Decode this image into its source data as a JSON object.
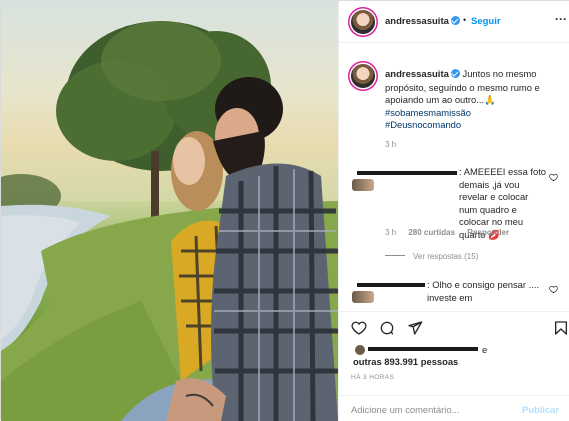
{
  "post": {
    "username": "andressasuita",
    "follow_label": "Seguir",
    "separator": "•",
    "more_label": "···"
  },
  "caption": {
    "username": "andressasuita",
    "text": " Juntos no mesmo propósito, seguindo o mesmo rumo e apoiando um ao outro...🙏",
    "hashtags": [
      "#sobamesmamissão",
      "#Deusnocomando"
    ],
    "time": "3 h"
  },
  "comments": [
    {
      "text": ": AMEEEEI essa foto demais ,já vou revelar e colocar num quadro e colocar no meu quarto 💋",
      "time": "3 h",
      "likes": "280 curtidas",
      "reply_label": "Responder",
      "view_replies": "Ver respostas (15)"
    },
    {
      "text": ": Olho e consigo pensar .... investe em"
    }
  ],
  "likes": {
    "prefix": "e",
    "others": "outras 893.991 pessoas"
  },
  "posted_ago": "HÁ 3 HORAS",
  "add_comment": {
    "placeholder": "Adicione um comentário...",
    "post_label": "Publicar"
  },
  "icons": {
    "verified": "verified-badge-icon",
    "heart": "heart-icon",
    "comment": "comment-icon",
    "share": "share-icon",
    "save": "bookmark-icon"
  },
  "colors": {
    "link": "#0095f6",
    "verified": "#3897f0",
    "hashtag": "#00376b",
    "muted": "#8e8e8e",
    "publish_disabled": "#b2dffc"
  }
}
